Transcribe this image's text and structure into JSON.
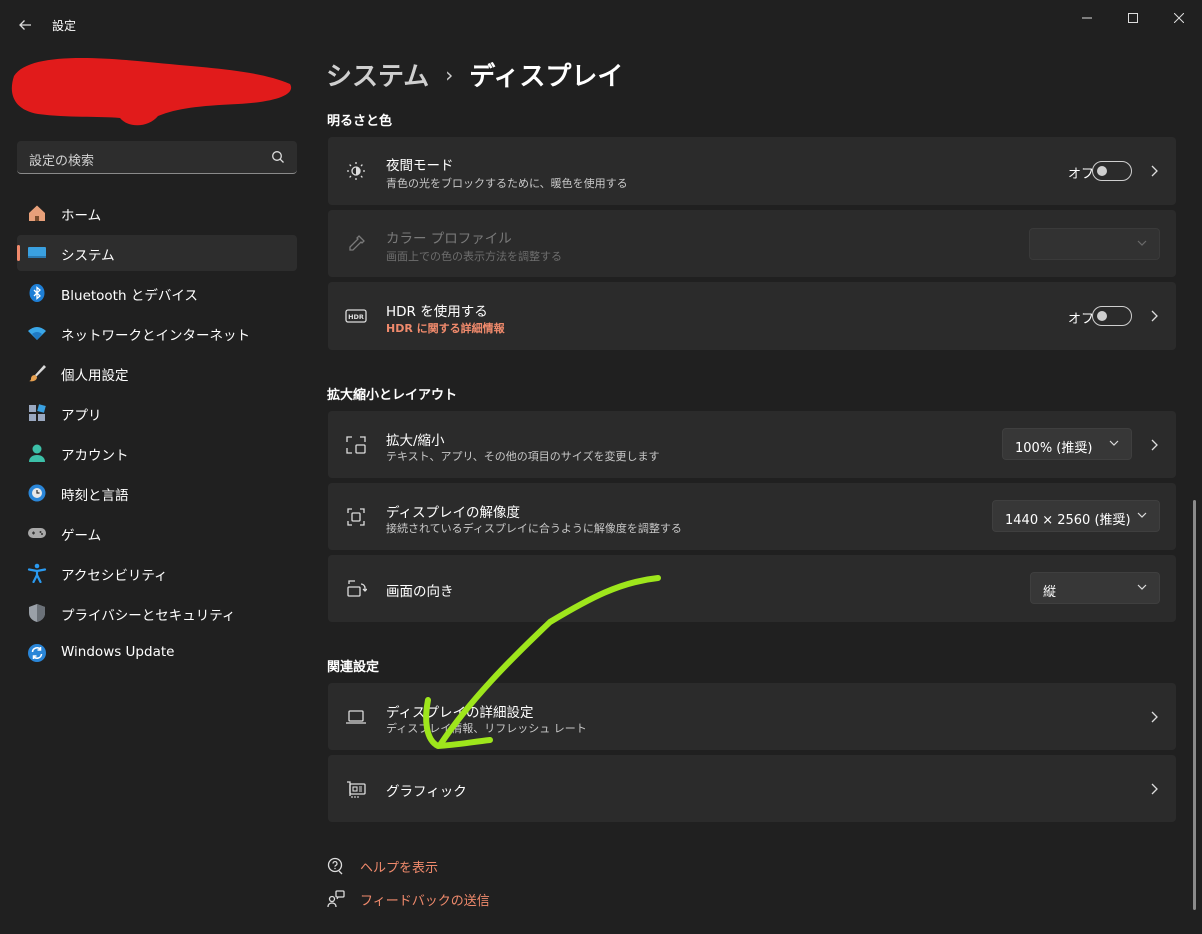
{
  "window": {
    "title": "設定",
    "minimize_glyph": "—",
    "maximize_glyph": "☐",
    "close_glyph": "✕"
  },
  "search": {
    "placeholder": "設定の検索"
  },
  "sidebar": {
    "items": [
      {
        "label": "ホーム",
        "icon": "home-icon"
      },
      {
        "label": "システム",
        "icon": "system-icon",
        "active": true
      },
      {
        "label": "Bluetooth とデバイス",
        "icon": "bluetooth-icon"
      },
      {
        "label": "ネットワークとインターネット",
        "icon": "wifi-icon"
      },
      {
        "label": "個人用設定",
        "icon": "brush-icon"
      },
      {
        "label": "アプリ",
        "icon": "apps-icon"
      },
      {
        "label": "アカウント",
        "icon": "account-icon"
      },
      {
        "label": "時刻と言語",
        "icon": "globe-clock-icon"
      },
      {
        "label": "ゲーム",
        "icon": "gamepad-icon"
      },
      {
        "label": "アクセシビリティ",
        "icon": "accessibility-icon"
      },
      {
        "label": "プライバシーとセキュリティ",
        "icon": "shield-icon"
      },
      {
        "label": "Windows Update",
        "icon": "update-icon"
      }
    ]
  },
  "breadcrumb": {
    "parent": "システム",
    "separator": "›",
    "current": "ディスプレイ"
  },
  "sections": {
    "brightness": {
      "title": "明るさと色",
      "night_light": {
        "title": "夜間モード",
        "subtitle": "青色の光をブロックするために、暖色を使用する",
        "toggle_label": "オフ",
        "icon": "sun-moon-icon"
      },
      "color_profile": {
        "title": "カラー プロファイル",
        "subtitle": "画面上での色の表示方法を調整する",
        "icon": "eyedropper-icon",
        "value": ""
      },
      "hdr": {
        "title": "HDR を使用する",
        "link": "HDR に関する詳細情報",
        "toggle_label": "オフ",
        "icon": "hdr-icon"
      }
    },
    "scale": {
      "title": "拡大縮小とレイアウト",
      "scale": {
        "title": "拡大/縮小",
        "subtitle": "テキスト、アプリ、その他の項目のサイズを変更します",
        "value": "100% (推奨)",
        "icon": "scale-icon"
      },
      "resolution": {
        "title": "ディスプレイの解像度",
        "subtitle": "接続されているディスプレイに合うように解像度を調整する",
        "value": "1440 × 2560 (推奨)",
        "icon": "resolution-icon"
      },
      "orientation": {
        "title": "画面の向き",
        "value": "縦",
        "icon": "rotate-screen-icon"
      }
    },
    "related": {
      "title": "関連設定",
      "advanced": {
        "title": "ディスプレイの詳細設定",
        "subtitle": "ディスプレイ情報、リフレッシュ レート",
        "icon": "laptop-icon"
      },
      "graphics": {
        "title": "グラフィック",
        "icon": "graphics-card-icon"
      }
    }
  },
  "footer": {
    "help": "ヘルプを表示",
    "feedback": "フィードバックの送信"
  },
  "colors": {
    "accent": "#f08a6c",
    "background": "#202020",
    "card": "#2b2b2b",
    "annotation_arrow": "#9ee61c",
    "redaction": "#e11b1b"
  }
}
